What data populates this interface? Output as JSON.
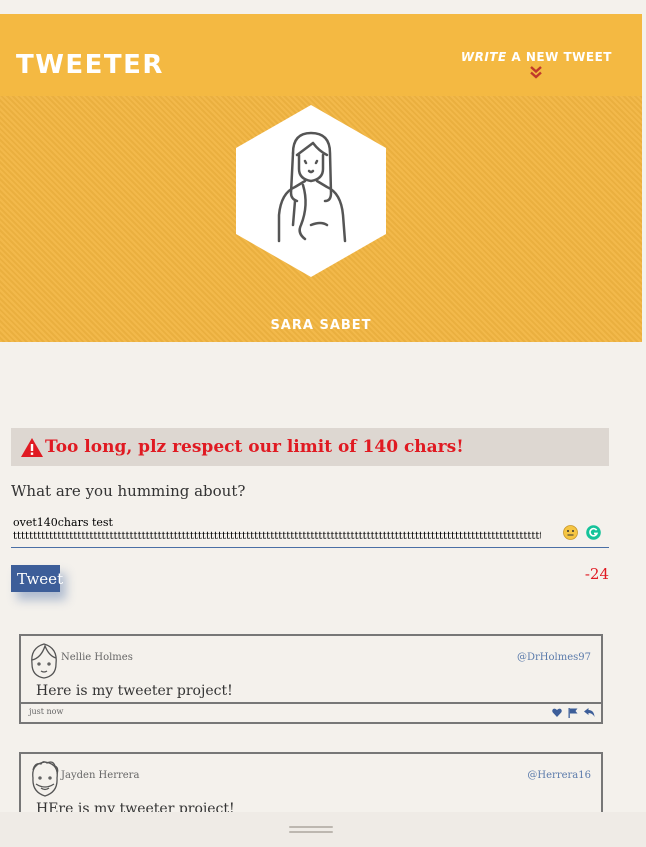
{
  "nav": {
    "brand": "Tweeter",
    "compose_write": "Write",
    "compose_rest": " a new tweet"
  },
  "profile": {
    "name": "Sara Sabet"
  },
  "composer": {
    "error": "Too long, plz respect our limit of 140 chars!",
    "prompt": "What are you humming about?",
    "text_line1": "ovet140chars test",
    "text_line2": "tttttttttttttttttttttttttttttttttttttttttttttttttttttttttttttttttttttttttttttttttttttttttttttttttttttttttttttttttttttttttttttttttttttttttttttttttttttttttttttttttttttttt",
    "button": "Tweet",
    "counter": "-24"
  },
  "tweets": [
    {
      "name": "Nellie Holmes",
      "handle": "@DrHolmes97",
      "text": "Here is my tweeter project!",
      "time": "just now"
    },
    {
      "name": "Jayden Herrera",
      "handle": "@Herrera16",
      "text": "HEre is my tweeter project!",
      "time": ""
    }
  ],
  "colors": {
    "accent": "#f4b942",
    "error": "#e01a22",
    "link": "#3d5e99"
  },
  "icons": [
    "double-chevron-down-icon",
    "warning-icon",
    "heart-icon",
    "flag-icon",
    "retweet-icon",
    "emoji-icon",
    "grammarly-icon"
  ]
}
